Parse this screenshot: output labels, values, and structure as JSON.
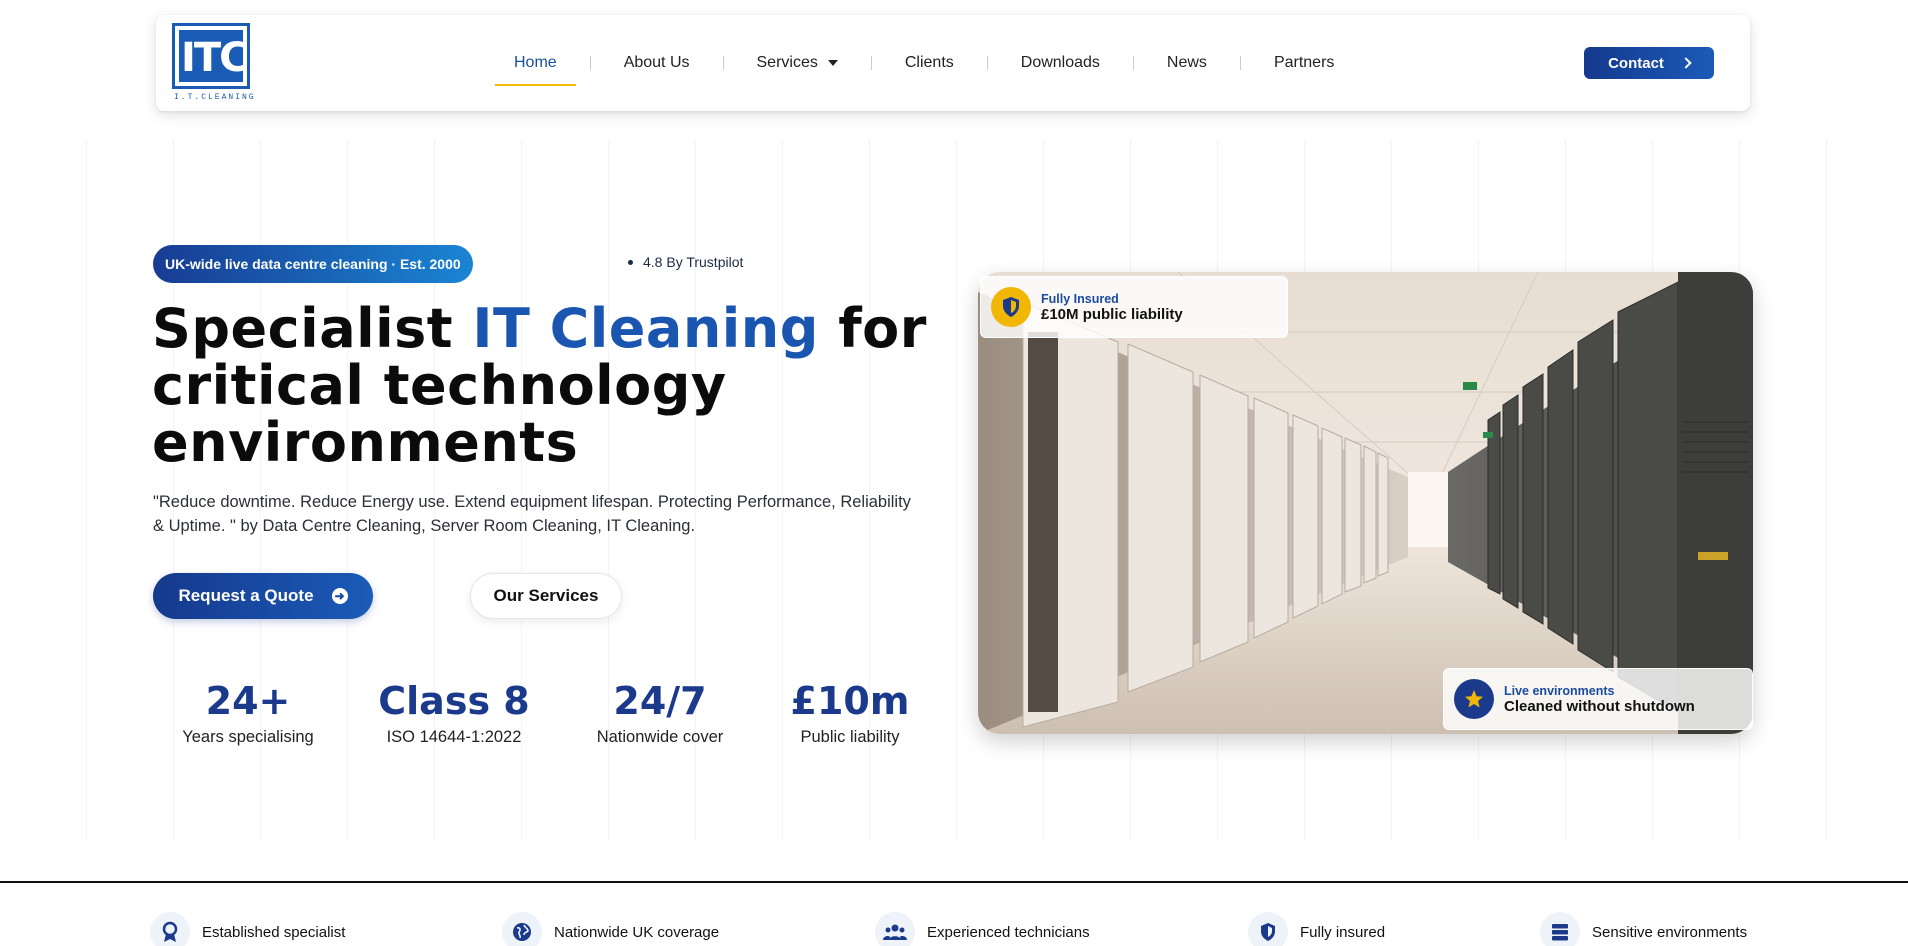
{
  "brand": {
    "logo_letters": "ITC",
    "logo_text": "I.T.CLEANING",
    "accent_color": "#1a55b0",
    "navy_color": "#1b3a8c",
    "highlight_color": "#f2b705"
  },
  "nav": {
    "items": [
      {
        "label": "Home",
        "active": true
      },
      {
        "label": "About Us"
      },
      {
        "label": "Services",
        "dropdown": true
      },
      {
        "label": "Clients"
      },
      {
        "label": "Downloads"
      },
      {
        "label": "News"
      },
      {
        "label": "Partners"
      }
    ],
    "contact_label": "Contact"
  },
  "hero": {
    "badge": "UK-wide live data centre cleaning · Est. 2000",
    "trust": "4.8 By Trustpilot",
    "headline_pre": "Specialist ",
    "headline_accent": "IT Cleaning",
    "headline_post": " for critical technology environments",
    "subtext": "\"Reduce downtime. Reduce Energy use. Extend equipment lifespan. Protecting Performance, Reliability & Uptime. \" by Data Centre Cleaning, Server Room Cleaning, IT Cleaning.",
    "quote_button": "Request a Quote",
    "services_button": "Our Services"
  },
  "stats": [
    {
      "value": "24+",
      "label": "Years specialising"
    },
    {
      "value": "Class 8",
      "label": "ISO 14644-1:2022"
    },
    {
      "value": "24/7",
      "label": "Nationwide cover"
    },
    {
      "value": "£10m",
      "label": "Public liability"
    }
  ],
  "cards": {
    "insured": {
      "small": "Fully Insured",
      "big": "£10M public liability",
      "icon": "shield-icon"
    },
    "live": {
      "small": "Live environments",
      "big": "Cleaned without shutdown",
      "icon": "star-icon"
    }
  },
  "features": [
    {
      "label": "Established specialist",
      "icon": "award-icon"
    },
    {
      "label": "Nationwide UK coverage",
      "icon": "globe-icon"
    },
    {
      "label": "Experienced technicians",
      "icon": "users-icon"
    },
    {
      "label": "Fully insured",
      "icon": "shield-icon"
    },
    {
      "label": "Sensitive environments",
      "icon": "server-icon"
    }
  ]
}
